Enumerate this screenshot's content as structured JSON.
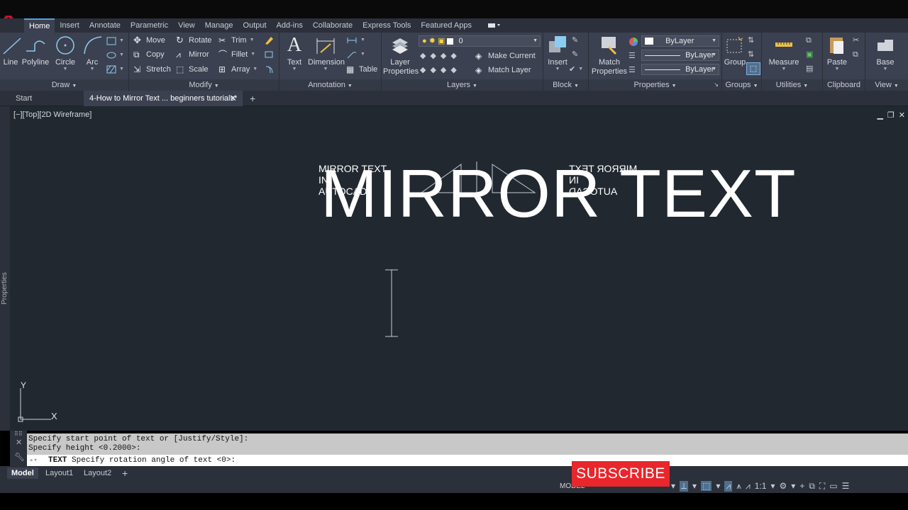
{
  "ribbon_tabs": [
    "Home",
    "Insert",
    "Annotate",
    "Parametric",
    "View",
    "Manage",
    "Output",
    "Add-ins",
    "Collaborate",
    "Express Tools",
    "Featured Apps"
  ],
  "draw": {
    "title": "Draw",
    "line": "Line",
    "polyline": "Polyline",
    "circle": "Circle",
    "arc": "Arc"
  },
  "modify": {
    "title": "Modify",
    "move": "Move",
    "rotate": "Rotate",
    "trim": "Trim",
    "copy": "Copy",
    "mirror": "Mirror",
    "fillet": "Fillet",
    "stretch": "Stretch",
    "scale": "Scale",
    "array": "Array"
  },
  "annotation": {
    "title": "Annotation",
    "text": "Text",
    "dimension": "Dimension",
    "table": "Table"
  },
  "layers": {
    "title": "Layers",
    "layer_properties": "Layer Properties",
    "current_layer": "0",
    "make_current": "Make Current",
    "match_layer": "Match Layer"
  },
  "block": {
    "title": "Block",
    "insert": "Insert"
  },
  "properties": {
    "title": "Properties",
    "match_properties": "Match Properties",
    "color": "ByLayer",
    "linetype": "ByLayer",
    "lineweight": "ByLayer"
  },
  "groups": {
    "title": "Groups",
    "group": "Group"
  },
  "utilities": {
    "title": "Utilities",
    "measure": "Measure"
  },
  "clipboard": {
    "title": "Clipboard",
    "paste": "Paste"
  },
  "view_panel": {
    "title": "View",
    "base": "Base"
  },
  "doc_tabs": {
    "start": "Start",
    "active": "4-How to Mirror Text ... beginners tutorials*"
  },
  "viewport_label": "[−][Top][2D Wireframe]",
  "drawing": {
    "small_text_lines": [
      "MIRROR TEXT",
      "IN",
      "AUTOCAD"
    ],
    "big_text": "MIRROR TEXT"
  },
  "properties_palette": "Properties",
  "ucs": {
    "x": "X",
    "y": "Y"
  },
  "command": {
    "history": [
      "Specify start point of text or [Justify/Style]:",
      "Specify height <0.2000>:"
    ],
    "input_keyword": "TEXT",
    "input_prompt": "Specify rotation angle of text <0>:"
  },
  "layout_tabs": [
    "Model",
    "Layout1",
    "Layout2"
  ],
  "subscribe": "SUBSCRIBE",
  "status": {
    "model": "MODEL",
    "scale": "1:1"
  },
  "colors": {
    "ribbon": "#3b4150",
    "canvas": "#212830",
    "accent": "#4aa3df",
    "subscribe": "#e8262b"
  }
}
